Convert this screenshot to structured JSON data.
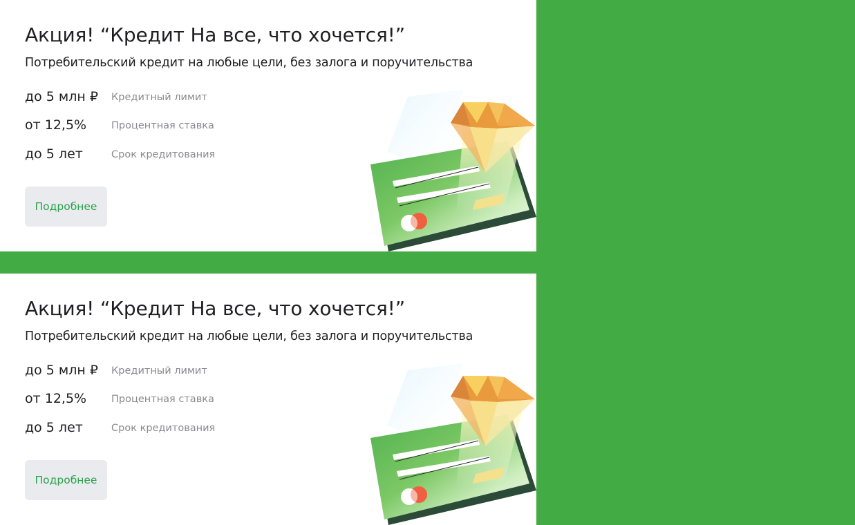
{
  "cards": [
    {
      "title": "Акция! “Кредит На все, что хочется!”",
      "subtitle": "Потребительский кредит на любые цели, без залога и поручительства",
      "params": [
        {
          "value": "до 5 млн ₽",
          "label": "Кредитный лимит"
        },
        {
          "value": "от 12,5%",
          "label": "Процентная ставка"
        },
        {
          "value": "до 5 лет",
          "label": "Срок кредитования"
        }
      ],
      "button_label": "Подробнее"
    },
    {
      "title": "Акция! “Кредит На все, что хочется!”",
      "subtitle": "Потребительский кредит на любые цели, без залога и поручительства",
      "params": [
        {
          "value": "до 5 млн ₽",
          "label": "Кредитный лимит"
        },
        {
          "value": "от 12,5%",
          "label": "Процентная ставка"
        },
        {
          "value": "до 5 лет",
          "label": "Срок кредитования"
        }
      ],
      "button_label": "Подробнее"
    }
  ],
  "colors": {
    "background": "#43ab43",
    "card": "#ffffff",
    "button_bg": "#e9ebef",
    "button_text": "#2aa24a",
    "text_primary": "#1f1f22",
    "text_secondary": "#8a8a8e"
  },
  "icons": {
    "illustration": "credit-card-with-diamond-icon"
  }
}
